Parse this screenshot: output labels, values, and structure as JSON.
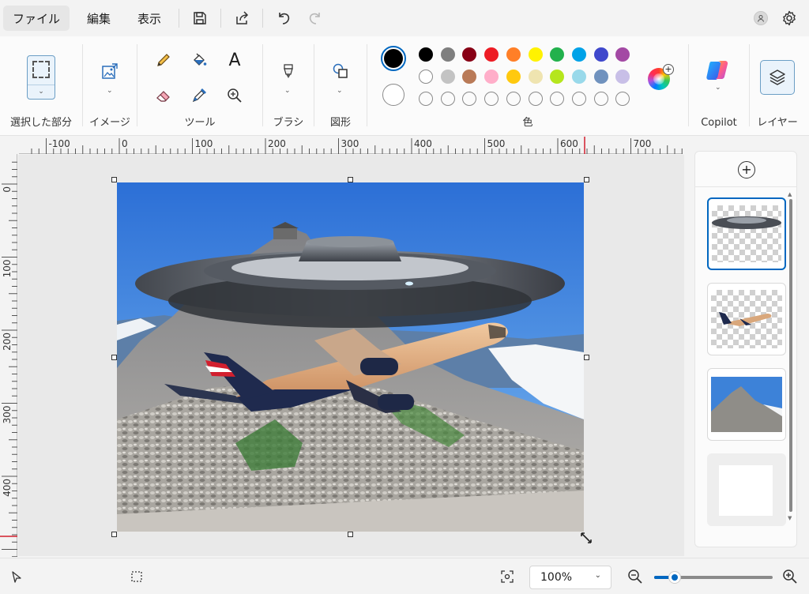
{
  "menu": {
    "items": [
      "ファイル",
      "編集",
      "表示"
    ],
    "quick_access": [
      "save-icon",
      "share-icon",
      "undo-icon",
      "redo-icon"
    ]
  },
  "ribbon": {
    "groups": {
      "selection": "選択した部分",
      "image": "イメージ",
      "tools": "ツール",
      "brushes": "ブラシ",
      "shapes": "図形",
      "colors": "色",
      "copilot": "Copilot",
      "layers": "レイヤー"
    },
    "tool_icons": [
      "pencil-icon",
      "fill-icon",
      "text-icon",
      "eraser-icon",
      "color-picker-icon",
      "magnifier-icon"
    ],
    "text_tool_glyph": "A"
  },
  "colors": {
    "primary": "#000000",
    "secondary": "#ffffff",
    "palette_row1": [
      "#000000",
      "#7f7f7f",
      "#880015",
      "#ed1c24",
      "#ff7f27",
      "#fff200",
      "#22b14c",
      "#00a2e8",
      "#3f48cc",
      "#a349a4"
    ],
    "palette_row2": [
      "#ffffff",
      "#c3c3c3",
      "#b97a57",
      "#ffaec9",
      "#ffc90e",
      "#efe4b0",
      "#b5e61d",
      "#99d9ea",
      "#7092be",
      "#c8bfe7"
    ],
    "palette_row3_custom_slots": 10,
    "accent": "#0067c0"
  },
  "ruler": {
    "horizontal_labels": [
      "-100",
      "0",
      "100",
      "200",
      "300",
      "400",
      "500",
      "600",
      "700"
    ],
    "vertical_labels": [
      "0",
      "100",
      "200",
      "300",
      "400"
    ]
  },
  "layers": {
    "add_icon": "add-layer-icon",
    "items": [
      "layer-ufo",
      "layer-airplane",
      "layer-mountain",
      "layer-background"
    ],
    "selected_index": 0
  },
  "status": {
    "zoom": "100%",
    "zoom_slider_fraction": 0.17
  }
}
